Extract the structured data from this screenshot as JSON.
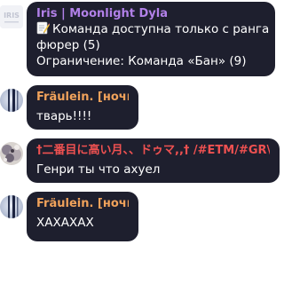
{
  "messages": [
    {
      "sender": "Iris | Moonlight Dyla",
      "avatar_label": "IRIS",
      "lines": [
        "Команда доступна только с ранга",
        "фюрер (5)",
        "Ограничение: Команда «Бан» (9)"
      ],
      "emoji": "memo-icon"
    },
    {
      "sender": "Fräulein. [ночь]",
      "lines": [
        "тварь!!!!"
      ]
    },
    {
      "sender": "†二番目に高い月、、ドゥマ,,† /#ETM/#GR\\\\",
      "lines": [
        "Генри ты что ахуел"
      ]
    },
    {
      "sender": "Fräulein. [ночь]",
      "lines": [
        "ХАХАХАХ"
      ]
    }
  ],
  "colors": {
    "bubble_bg": "#1e1f2e",
    "sender_violet": "#b180e8",
    "sender_orange": "#f0a25b",
    "sender_red": "#ef5151",
    "text": "#ffffff"
  }
}
